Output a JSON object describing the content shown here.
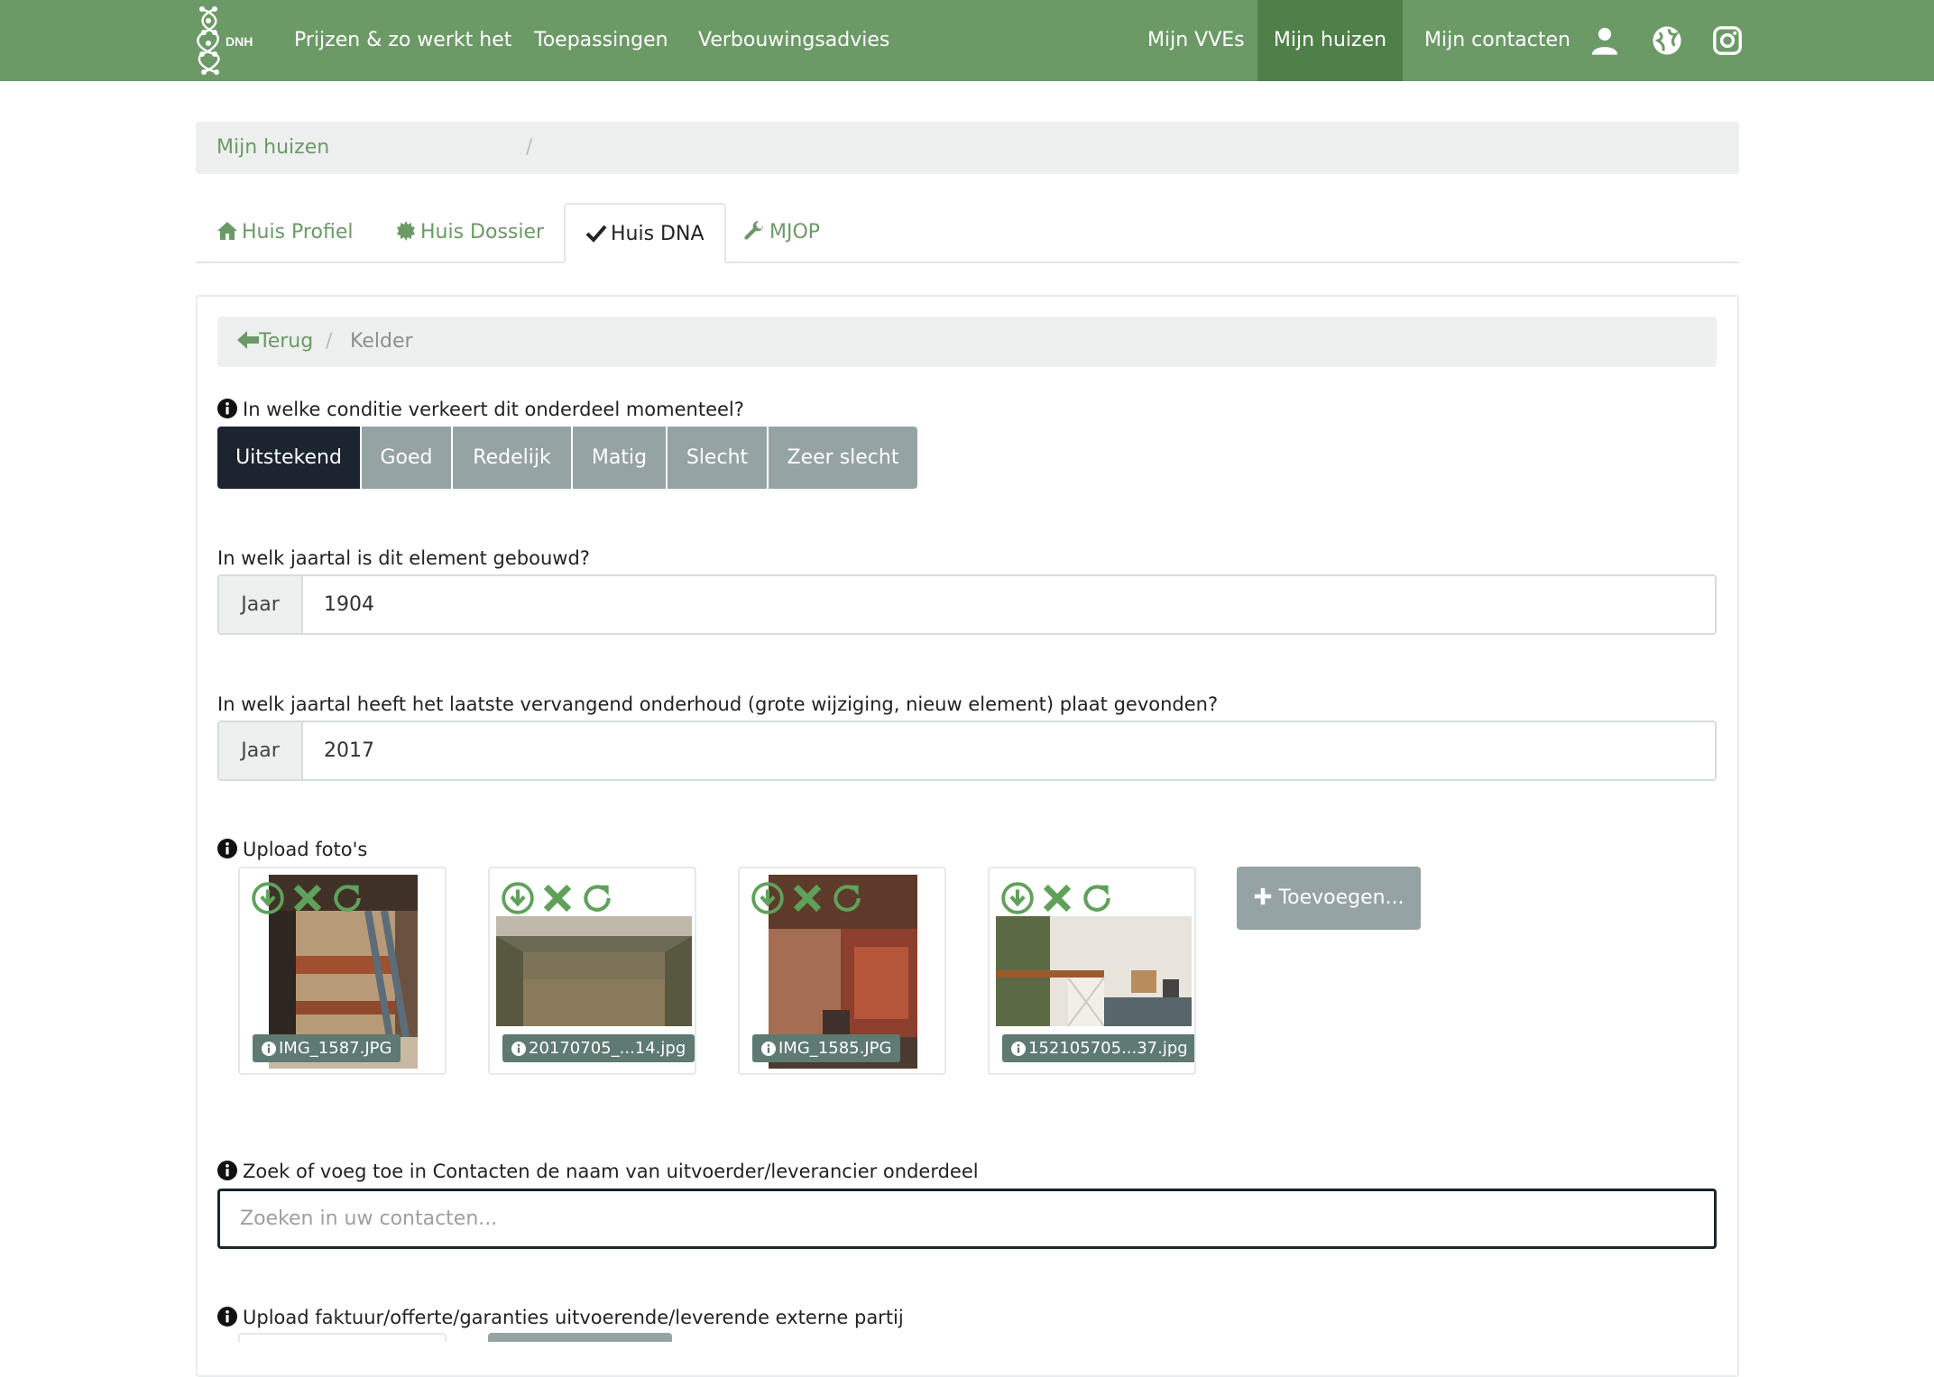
{
  "navbar": {
    "brand": "DNH",
    "links": [
      "Prijzen & zo werkt het",
      "Toepassingen",
      "Verbouwingsadvies"
    ],
    "right_links": [
      "Mijn VVEs",
      "Mijn huizen",
      "Mijn contacten"
    ],
    "active": "Mijn huizen",
    "icons": [
      "user-icon",
      "globe-icon",
      "instagram-icon"
    ],
    "color": "#6b9a66",
    "active_color": "#4f8049"
  },
  "breadcrumb": {
    "item": "Mijn huizen",
    "separator": "/"
  },
  "tabs": [
    {
      "label": "Huis Profiel",
      "icon": "home-icon"
    },
    {
      "label": "Huis Dossier",
      "icon": "certificate-icon"
    },
    {
      "label": "Huis DNA",
      "icon": "check-icon",
      "active": true
    },
    {
      "label": "MJOP",
      "icon": "wrench-icon"
    }
  ],
  "inner_breadcrumb": {
    "back": "Terug",
    "separator": "/",
    "current": "Kelder"
  },
  "condition": {
    "question": "In welke conditie verkeert dit onderdeel momenteel?",
    "options": [
      "Uitstekend",
      "Goed",
      "Redelijk",
      "Matig",
      "Slecht",
      "Zeer slecht"
    ],
    "selected": "Uitstekend"
  },
  "build_year": {
    "question": "In welk jaartal is dit element gebouwd?",
    "addon": "Jaar",
    "value": "1904"
  },
  "maintenance_year": {
    "question": "In welk jaartal heeft het laatste vervangend onderhoud (grote wijziging, nieuw element) plaat gevonden?",
    "addon": "Jaar",
    "value": "2017"
  },
  "photos": {
    "label": "Upload foto's",
    "items": [
      {
        "name": "IMG_1587.JPG"
      },
      {
        "name": "20170705_...14.jpg"
      },
      {
        "name": "IMG_1585.JPG"
      },
      {
        "name": "152105705...37.jpg"
      }
    ],
    "add_label": "Toevoegen..."
  },
  "contact": {
    "label": "Zoek of voeg toe in Contacten de naam van uitvoerder/leverancier onderdeel",
    "placeholder": "Zoeken in uw contacten..."
  },
  "invoice": {
    "label": "Upload faktuur/offerte/garanties uitvoerende/leverende externe partij"
  }
}
